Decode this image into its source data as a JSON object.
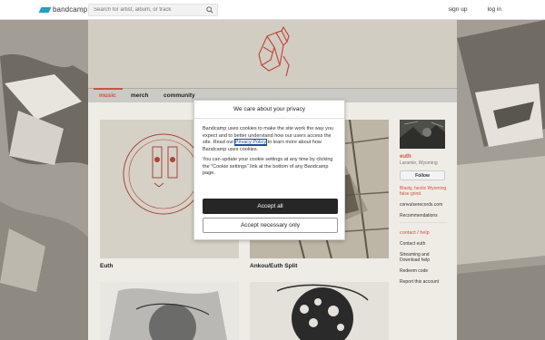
{
  "topbar": {
    "logo_text": "bandcamp",
    "search_placeholder": "Search for artist, album, or track",
    "signup": "sign up",
    "login": "log in"
  },
  "nav": {
    "music": "music",
    "merch": "merch",
    "community": "community"
  },
  "albums": [
    {
      "title": "Euth"
    },
    {
      "title": "Ankou/Euth Split"
    },
    {
      "title": ""
    },
    {
      "title": ""
    }
  ],
  "sidebar": {
    "band_name": "euth",
    "location": "Laramie, Wyoming",
    "follow": "Follow",
    "bio": "Blasty, hectic Wyoming false grind.",
    "website": "convulserecords.com",
    "recommendations": "Recommendations",
    "contact_help": "contact / help",
    "contact": "Contact euth",
    "streaming": "Streaming and Download help",
    "redeem": "Redeem code",
    "report": "Report this account"
  },
  "modal": {
    "title": "We care about your privacy",
    "text1_a": "Bandcamp uses cookies to make the site work the way you expect and to better understand how our users access the site. Read our ",
    "privacy_link": "Privacy Policy",
    "text1_b": " to learn more about how Bandcamp uses cookies.",
    "text2": "You can update your cookie settings at any time by clicking the \"Cookie settings\" link at the bottom of any Bandcamp page.",
    "accept_all": "Accept all",
    "accept_necessary": "Accept necessary only"
  },
  "colors": {
    "accent": "#d44f3f",
    "logo": "#1da0c3",
    "link": "#1a4fa0"
  }
}
